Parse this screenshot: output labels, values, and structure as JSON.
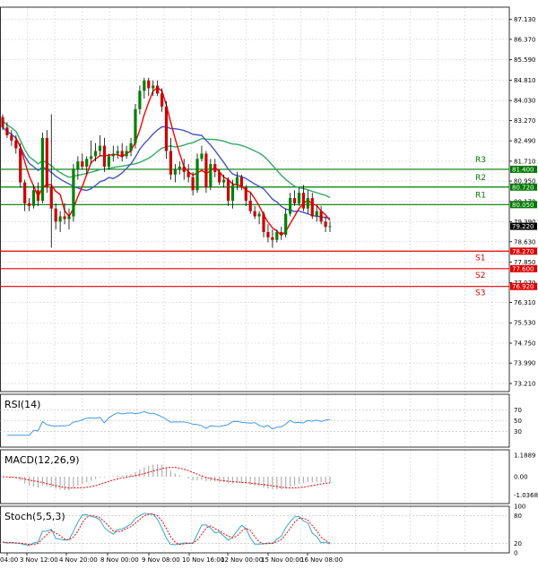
{
  "chart_data": {
    "type": "candlestick",
    "main": {
      "price_axis": {
        "range": [
          72.9,
          87.6
        ],
        "ticks": [
          "87.130",
          "86.370",
          "85.590",
          "84.810",
          "84.030",
          "83.270",
          "82.490",
          "81.710",
          "80.950",
          "80.170",
          "79.390",
          "78.630",
          "77.850",
          "77.070",
          "76.310",
          "75.530",
          "74.750",
          "73.990",
          "73.210"
        ]
      },
      "time_axis": {
        "labels": [
          "04:00",
          "3 Nov 12:00",
          "4 Nov 20:00",
          "8 Nov 00:00",
          "9 Nov 08:00",
          "10 Nov 16:00",
          "12 Nov 00:00",
          "15 Nov 00:00",
          "16 Nov 08:00"
        ]
      },
      "current_price": "79.220",
      "levels": [
        {
          "name": "R3",
          "value": 81.4,
          "price_label": "81.400",
          "color": "#007a00"
        },
        {
          "name": "R2",
          "value": 80.72,
          "price_label": "80.720",
          "color": "#007a00"
        },
        {
          "name": "R1",
          "value": 80.05,
          "price_label": "80.050",
          "color": "#007a00"
        },
        {
          "name": "S1",
          "value": 78.27,
          "price_label": "78.270",
          "color": "#e00000"
        },
        {
          "name": "S2",
          "value": 77.6,
          "price_label": "77.600",
          "color": "#e00000"
        },
        {
          "name": "S3",
          "value": 76.92,
          "price_label": "76.920",
          "color": "#e00000"
        }
      ],
      "candles_ohlc": [
        [
          83.4,
          83.5,
          82.9,
          83.0
        ],
        [
          83.0,
          83.2,
          82.6,
          82.7
        ],
        [
          82.7,
          82.9,
          82.3,
          82.5
        ],
        [
          82.5,
          82.7,
          82.0,
          82.2
        ],
        [
          82.2,
          82.4,
          80.7,
          80.9
        ],
        [
          80.9,
          81.0,
          79.8,
          80.1
        ],
        [
          80.1,
          80.3,
          79.8,
          80.0
        ],
        [
          80.0,
          80.8,
          79.9,
          80.6
        ],
        [
          80.6,
          80.9,
          80.0,
          80.2
        ],
        [
          80.2,
          82.8,
          80.1,
          82.6
        ],
        [
          82.6,
          82.9,
          80.5,
          80.7
        ],
        [
          80.7,
          83.5,
          78.4,
          79.9
        ],
        [
          79.9,
          80.1,
          79.1,
          79.4
        ],
        [
          79.4,
          79.8,
          79.0,
          79.6
        ],
        [
          79.6,
          80.1,
          79.3,
          79.5
        ],
        [
          79.5,
          79.9,
          79.1,
          79.6
        ],
        [
          79.6,
          81.6,
          79.4,
          81.4
        ],
        [
          81.4,
          81.9,
          81.0,
          81.7
        ],
        [
          81.7,
          82.0,
          81.4,
          81.5
        ],
        [
          81.5,
          81.9,
          81.2,
          81.8
        ],
        [
          81.8,
          82.5,
          81.6,
          81.9
        ],
        [
          81.9,
          82.4,
          81.7,
          82.1
        ],
        [
          82.1,
          82.7,
          81.9,
          82.3
        ],
        [
          82.3,
          82.6,
          81.3,
          81.5
        ],
        [
          81.5,
          82.0,
          81.4,
          81.9
        ],
        [
          81.9,
          82.3,
          81.7,
          82.0
        ],
        [
          82.0,
          82.3,
          81.8,
          82.1
        ],
        [
          82.1,
          82.4,
          81.7,
          81.9
        ],
        [
          81.9,
          82.3,
          81.8,
          82.1
        ],
        [
          82.1,
          82.6,
          81.9,
          82.4
        ],
        [
          82.4,
          83.9,
          82.2,
          83.7
        ],
        [
          83.7,
          84.6,
          83.5,
          84.4
        ],
        [
          84.4,
          84.9,
          84.1,
          84.8
        ],
        [
          84.8,
          84.9,
          84.2,
          84.5
        ],
        [
          84.5,
          84.8,
          84.2,
          84.6
        ],
        [
          84.6,
          84.8,
          84.2,
          84.3
        ],
        [
          84.3,
          84.5,
          83.6,
          83.8
        ],
        [
          83.8,
          84.0,
          81.8,
          82.1
        ],
        [
          82.1,
          82.6,
          81.0,
          81.2
        ],
        [
          81.2,
          81.6,
          80.9,
          81.4
        ],
        [
          81.4,
          81.7,
          81.2,
          81.5
        ],
        [
          81.5,
          81.8,
          81.0,
          81.3
        ],
        [
          81.3,
          81.6,
          80.9,
          81.1
        ],
        [
          81.1,
          81.3,
          80.4,
          80.6
        ],
        [
          80.6,
          82.0,
          80.5,
          81.8
        ],
        [
          81.8,
          82.3,
          81.7,
          82.0
        ],
        [
          82.0,
          82.1,
          80.5,
          80.7
        ],
        [
          80.7,
          81.8,
          80.6,
          81.6
        ],
        [
          81.6,
          81.8,
          81.1,
          81.3
        ],
        [
          81.3,
          81.4,
          80.8,
          80.9
        ],
        [
          80.9,
          81.2,
          80.7,
          81.0
        ],
        [
          81.0,
          81.1,
          80.0,
          80.2
        ],
        [
          80.2,
          81.0,
          79.9,
          80.8
        ],
        [
          80.8,
          81.3,
          80.6,
          81.1
        ],
        [
          81.1,
          81.2,
          80.6,
          80.7
        ],
        [
          80.7,
          80.8,
          80.0,
          80.2
        ],
        [
          80.2,
          80.5,
          79.7,
          79.8
        ],
        [
          79.8,
          80.0,
          79.5,
          79.6
        ],
        [
          79.6,
          79.8,
          79.3,
          79.7
        ],
        [
          79.7,
          79.8,
          78.8,
          79.0
        ],
        [
          79.0,
          79.3,
          78.6,
          78.8
        ],
        [
          78.8,
          79.1,
          78.4,
          78.7
        ],
        [
          78.7,
          79.1,
          78.6,
          79.0
        ],
        [
          79.0,
          79.2,
          78.7,
          78.9
        ],
        [
          78.9,
          79.9,
          78.8,
          79.7
        ],
        [
          79.7,
          80.5,
          79.6,
          80.3
        ],
        [
          80.3,
          80.6,
          80.0,
          80.1
        ],
        [
          80.1,
          80.7,
          80.0,
          80.5
        ],
        [
          80.5,
          80.8,
          79.8,
          79.9
        ],
        [
          79.9,
          80.6,
          79.7,
          80.3
        ],
        [
          80.3,
          80.5,
          79.5,
          79.6
        ],
        [
          79.6,
          80.0,
          79.4,
          79.8
        ],
        [
          79.8,
          80.0,
          79.3,
          79.4
        ],
        [
          79.4,
          79.6,
          79.0,
          79.2
        ],
        [
          79.2,
          79.4,
          79.0,
          79.22
        ]
      ]
    },
    "indicators": [
      {
        "name": "RSI(14)",
        "ticks": [
          "70",
          "50",
          "30"
        ]
      },
      {
        "name": "MACD(12,26,9)",
        "ticks": [
          "1.1889",
          "0.00",
          "-1.0368"
        ]
      },
      {
        "name": "Stoch(5,5,3)",
        "ticks": [
          "100",
          "80",
          "20",
          "0"
        ]
      }
    ],
    "colors": {
      "up": "#008000",
      "down": "#cc0000",
      "wick": "#000000",
      "ma_fast": "#ff0000",
      "ma_mid": "#4455cc",
      "ma_slow": "#33aa66",
      "rsi": "#4499ee",
      "macd_hist": "#b0b0b0",
      "macd_signal": "#ff0000",
      "stoch_main": "#33aacc",
      "stoch_signal": "#ff0000"
    }
  }
}
